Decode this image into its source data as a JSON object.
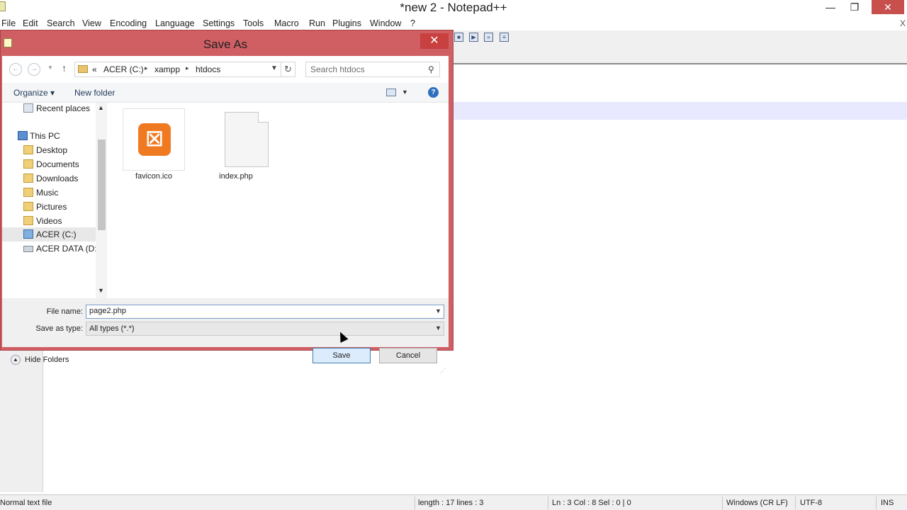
{
  "app": {
    "title": "*new 2 - Notepad++",
    "menu": [
      "File",
      "Edit",
      "Search",
      "View",
      "Encoding",
      "Language",
      "Settings",
      "Tools",
      "Macro",
      "Run",
      "Plugins",
      "Window",
      "?"
    ],
    "close_doc": "X",
    "window_buttons": {
      "minimize": "—",
      "maximize": "❐",
      "close": "✕"
    },
    "status": {
      "type": "Normal text file",
      "length_lines": "length : 17    lines : 3",
      "position": "Ln : 3    Col : 8    Sel : 0 | 0",
      "eol": "Windows (CR LF)",
      "encoding": "UTF-8",
      "mode": "INS"
    }
  },
  "dialog": {
    "title": "Save As",
    "close": "✕",
    "address": {
      "prefix": "«",
      "crumbs": [
        "ACER (C:)",
        "xampp",
        "htdocs"
      ]
    },
    "search_placeholder": "Search htdocs",
    "toolbar": {
      "organize": "Organize ▾",
      "new_folder": "New folder",
      "help": "?"
    },
    "nav_items": [
      {
        "label": "Recent places",
        "icon": "recent-places-icon"
      },
      {
        "label": "This PC",
        "icon": "computer-icon"
      },
      {
        "label": "Desktop",
        "icon": "folder-icon"
      },
      {
        "label": "Documents",
        "icon": "folder-icon"
      },
      {
        "label": "Downloads",
        "icon": "folder-icon"
      },
      {
        "label": "Music",
        "icon": "folder-icon"
      },
      {
        "label": "Pictures",
        "icon": "folder-icon"
      },
      {
        "label": "Videos",
        "icon": "folder-icon"
      },
      {
        "label": "ACER (C:)",
        "icon": "drive-icon",
        "selected": true
      },
      {
        "label": "ACER DATA (D:)",
        "icon": "drive-icon"
      }
    ],
    "files": [
      {
        "name": "favicon.ico",
        "icon": "xampp-icon",
        "glyph": "☒"
      },
      {
        "name": "index.php",
        "icon": "blank-document-icon"
      }
    ],
    "file_name_label": "File name:",
    "file_name_value": "page2.php",
    "save_as_type_label": "Save as type:",
    "save_as_type_value": "All types (*.*)",
    "hide_folders": "Hide Folders",
    "save_button": "Save",
    "cancel_button": "Cancel"
  }
}
